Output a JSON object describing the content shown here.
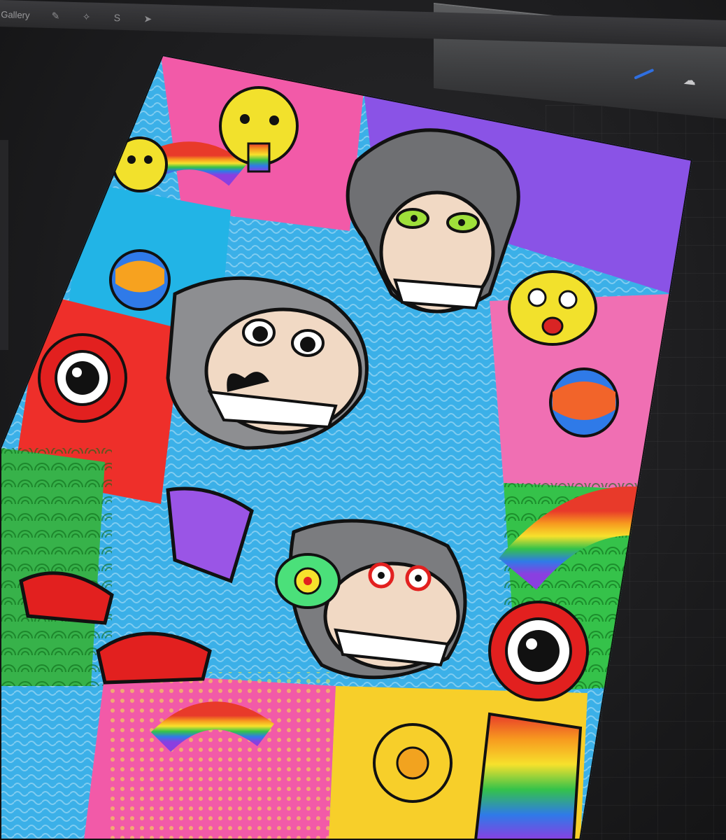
{
  "toolbar": {
    "gallery_label": "Gallery"
  },
  "icons": {
    "actions": "wrench-icon",
    "adjustments": "magic-wand-icon",
    "selection": "selection-s-icon",
    "transform": "arrow-cursor-icon",
    "brush": "brush-icon",
    "smudge": "smudge-icon"
  },
  "colors": {
    "accent": "#2f6fe0",
    "surround": "#1b1b1d"
  }
}
